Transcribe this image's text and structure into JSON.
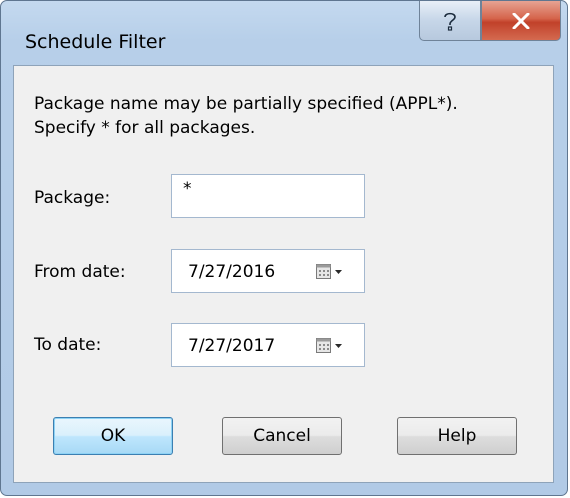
{
  "window": {
    "title": "Schedule Filter",
    "help_icon": "question-mark-icon",
    "close_icon": "close-x-icon"
  },
  "description": {
    "line1": "Package name may be partially specified (APPL*).",
    "line2": "Specify * for all packages."
  },
  "form": {
    "package_label": "Package:",
    "package_value": "*",
    "from_label": "From date:",
    "from_value": "7/27/2016",
    "to_label": "To date:",
    "to_value": "7/27/2017",
    "calendar_icon": "calendar-dropdown-icon"
  },
  "buttons": {
    "ok": "OK",
    "cancel": "Cancel",
    "help": "Help"
  },
  "colors": {
    "close_button": "#c94a32",
    "default_button_border": "#3c7fb1",
    "frame": "#b7cfe9"
  }
}
